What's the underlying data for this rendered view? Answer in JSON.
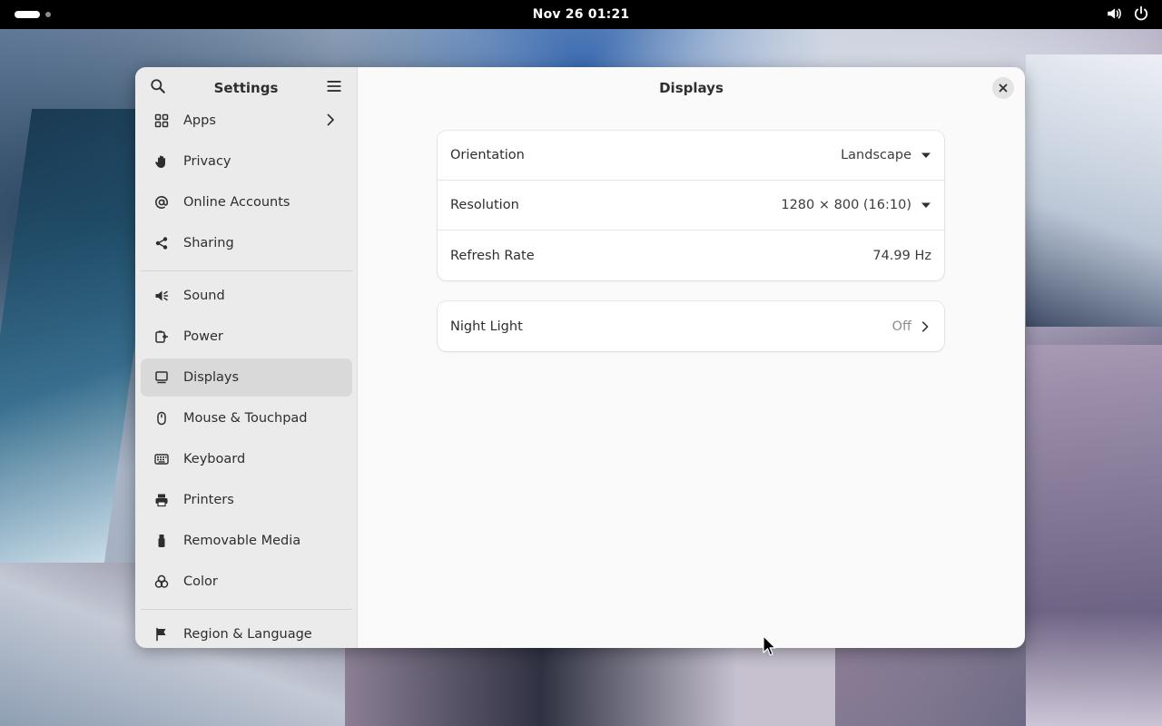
{
  "topbar": {
    "clock": "Nov 26  01:21",
    "icons": [
      "volume-icon",
      "power-icon"
    ]
  },
  "sidebar": {
    "title": "Settings",
    "items": [
      {
        "label": "Apps",
        "icon": "apps-icon",
        "has_arrow": true
      },
      {
        "label": "Privacy",
        "icon": "hand-icon"
      },
      {
        "label": "Online Accounts",
        "icon": "at-icon"
      },
      {
        "label": "Sharing",
        "icon": "share-icon"
      },
      {
        "label": "Sound",
        "icon": "speaker-icon"
      },
      {
        "label": "Power",
        "icon": "battery-plug-icon"
      },
      {
        "label": "Displays",
        "icon": "monitor-icon",
        "selected": true
      },
      {
        "label": "Mouse & Touchpad",
        "icon": "mouse-icon"
      },
      {
        "label": "Keyboard",
        "icon": "keyboard-icon"
      },
      {
        "label": "Printers",
        "icon": "printer-icon"
      },
      {
        "label": "Removable Media",
        "icon": "usb-icon"
      },
      {
        "label": "Color",
        "icon": "color-icon"
      },
      {
        "label": "Region & Language",
        "icon": "flag-icon"
      }
    ]
  },
  "main": {
    "title": "Displays",
    "display_settings": {
      "orientation": {
        "label": "Orientation",
        "value": "Landscape"
      },
      "resolution": {
        "label": "Resolution",
        "value": "1280 × 800 (16:10)"
      },
      "refresh_rate": {
        "label": "Refresh Rate",
        "value": "74.99 Hz"
      }
    },
    "night_light": {
      "label": "Night Light",
      "value": "Off"
    }
  }
}
